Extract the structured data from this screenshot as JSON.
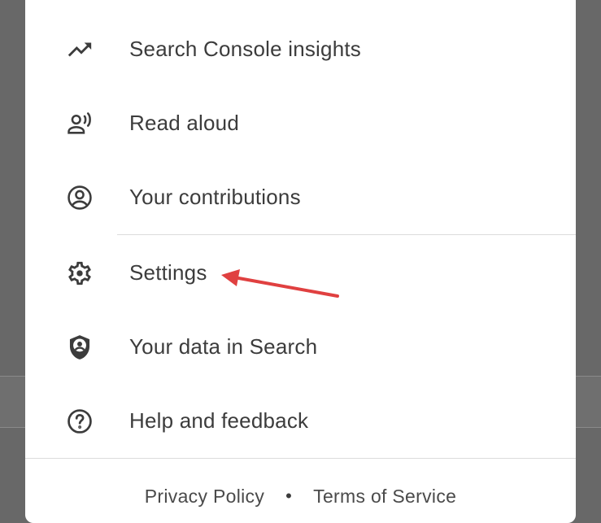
{
  "menu": {
    "items": [
      {
        "label": "Search Console insights",
        "icon": "trending-up-icon"
      },
      {
        "label": "Read aloud",
        "icon": "record-voice-icon"
      },
      {
        "label": "Your contributions",
        "icon": "account-circle-icon"
      },
      {
        "label": "Settings",
        "icon": "gear-icon"
      },
      {
        "label": "Your data in Search",
        "icon": "shield-person-icon"
      },
      {
        "label": "Help and feedback",
        "icon": "help-circle-icon"
      }
    ]
  },
  "footer": {
    "privacy_label": "Privacy Policy",
    "separator": "•",
    "terms_label": "Terms of Service"
  },
  "annotation": {
    "arrow_color": "#e04040",
    "points_to": "Settings"
  }
}
